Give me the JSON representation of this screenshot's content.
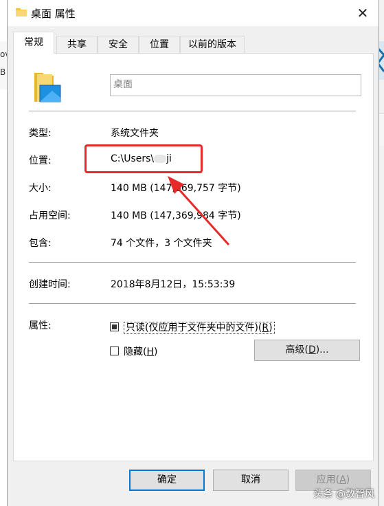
{
  "window": {
    "title": "桌面 属性",
    "close_glyph": "✕"
  },
  "background": {
    "left_chars": [
      "ov",
      "B"
    ]
  },
  "tabs": [
    {
      "label": "常规",
      "active": true
    },
    {
      "label": "共享",
      "active": false
    },
    {
      "label": "安全",
      "active": false
    },
    {
      "label": "位置",
      "active": false
    },
    {
      "label": "以前的版本",
      "active": false
    }
  ],
  "general": {
    "name_value": "桌面",
    "type_label": "类型:",
    "type_value": "系统文件夹",
    "location_label": "位置:",
    "location_value": "C:\\Users\\",
    "location_tail": "ji",
    "size_label": "大小:",
    "size_value": "140 MB (147,369,757 字节)",
    "disk_size_label": "占用空间:",
    "disk_size_value": "140 MB (147,369,984 字节)",
    "contains_label": "包含:",
    "contains_value": "74 个文件，3 个文件夹",
    "created_label": "创建时间:",
    "created_value": "2018年8月12日，15:53:39",
    "attributes_label": "属性:",
    "readonly_label": "只读(仅应用于文件夹中的文件)(",
    "readonly_key": "R",
    "readonly_checked": true,
    "hidden_label": "隐藏(",
    "hidden_key": "H",
    "hidden_checked": false,
    "advanced_label": "高级(",
    "advanced_key": "D",
    "advanced_suffix": ")..."
  },
  "buttons": {
    "ok": "确定",
    "cancel": "取消",
    "apply": "应用(",
    "apply_key": "A"
  },
  "watermark": "头条 @数智风",
  "colors": {
    "annotation": "#e62a2a",
    "default_button_border": "#0078d7",
    "folder_yellow": "#f5c542",
    "folder_blue": "#1e90e0"
  },
  "icons": [
    "folder-icon",
    "close-icon",
    "checkbox-icon"
  ]
}
